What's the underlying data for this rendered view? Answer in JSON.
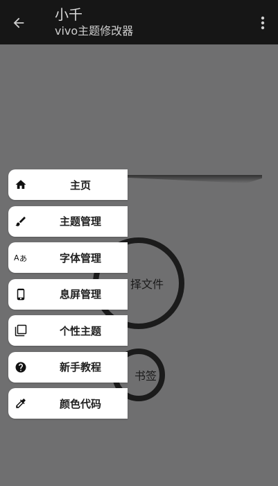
{
  "appbar": {
    "title": "小千",
    "subtitle": "vivo主题修改器"
  },
  "rings": {
    "big_label": "择文件",
    "small_label": "书签"
  },
  "menu": {
    "items": [
      {
        "label": "主页",
        "icon": "home-icon"
      },
      {
        "label": "主题管理",
        "icon": "brush-icon"
      },
      {
        "label": "字体管理",
        "icon": "translate-icon"
      },
      {
        "label": "息屏管理",
        "icon": "phone-icon"
      },
      {
        "label": "个性主题",
        "icon": "copy-squares-icon"
      },
      {
        "label": "新手教程",
        "icon": "help-circle-icon"
      },
      {
        "label": "颜色代码",
        "icon": "eyedropper-icon"
      }
    ]
  },
  "colors": {
    "appbar_bg": "#161616",
    "scrim": "#6f6f70",
    "menu_bg": "#ffffff"
  }
}
